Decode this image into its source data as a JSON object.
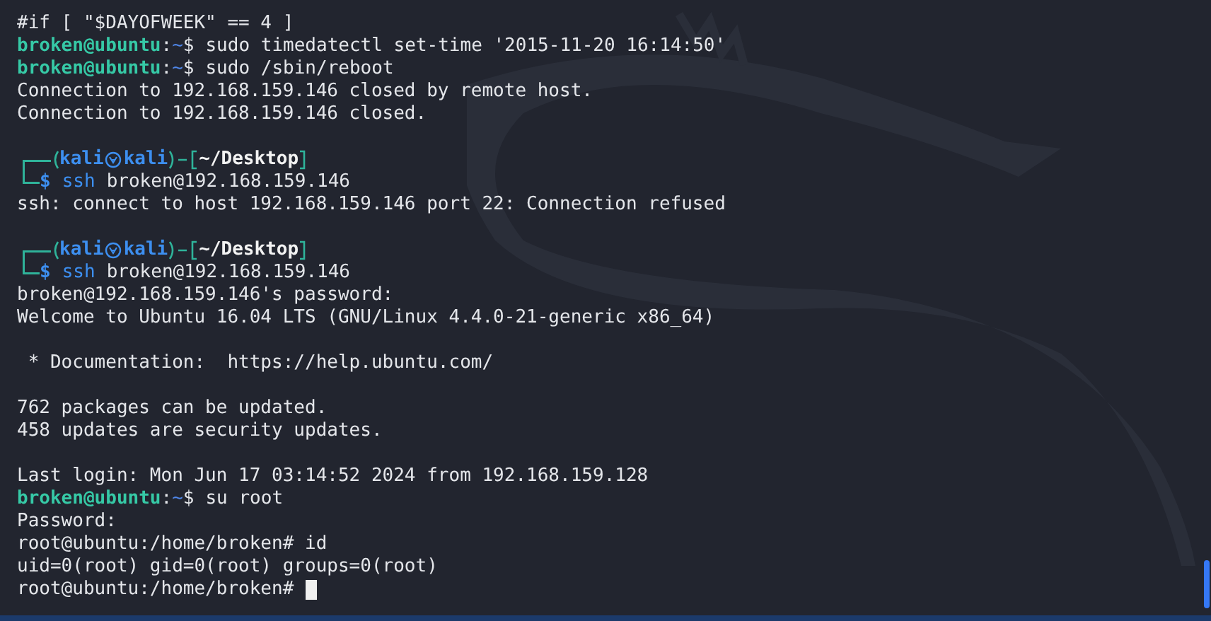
{
  "terminal": {
    "lines": [
      {
        "kind": "plain",
        "text": "#if [ \"$DAYOFWEEK\" == 4 ]"
      },
      {
        "kind": "ubuntu_prompt",
        "user_host": "broken@ubuntu",
        "separator": ":",
        "path": "~",
        "symbol": "$",
        "command": "sudo timedatectl set-time '2015-11-20 16:14:50'"
      },
      {
        "kind": "ubuntu_prompt",
        "user_host": "broken@ubuntu",
        "separator": ":",
        "path": "~",
        "symbol": "$",
        "command": "sudo /sbin/reboot"
      },
      {
        "kind": "plain",
        "text": "Connection to 192.168.159.146 closed by remote host."
      },
      {
        "kind": "plain",
        "text": "Connection to 192.168.159.146 closed."
      },
      {
        "kind": "blank"
      },
      {
        "kind": "kali_prompt",
        "user": "kali",
        "host": "kali",
        "directory": "~/Desktop",
        "symbol": "$",
        "program": "ssh",
        "arguments": "broken@192.168.159.146"
      },
      {
        "kind": "plain",
        "text": "ssh: connect to host 192.168.159.146 port 22: Connection refused"
      },
      {
        "kind": "blank"
      },
      {
        "kind": "kali_prompt",
        "user": "kali",
        "host": "kali",
        "directory": "~/Desktop",
        "symbol": "$",
        "program": "ssh",
        "arguments": "broken@192.168.159.146"
      },
      {
        "kind": "plain",
        "text": "broken@192.168.159.146's password:"
      },
      {
        "kind": "plain",
        "text": "Welcome to Ubuntu 16.04 LTS (GNU/Linux 4.4.0-21-generic x86_64)"
      },
      {
        "kind": "blank"
      },
      {
        "kind": "plain",
        "text": " * Documentation:  https://help.ubuntu.com/"
      },
      {
        "kind": "blank"
      },
      {
        "kind": "plain",
        "text": "762 packages can be updated."
      },
      {
        "kind": "plain",
        "text": "458 updates are security updates."
      },
      {
        "kind": "blank"
      },
      {
        "kind": "plain",
        "text": "Last login: Mon Jun 17 03:14:52 2024 from 192.168.159.128"
      },
      {
        "kind": "ubuntu_prompt",
        "user_host": "broken@ubuntu",
        "separator": ":",
        "path": "~",
        "symbol": "$",
        "command": "su root"
      },
      {
        "kind": "plain",
        "text": "Password:"
      },
      {
        "kind": "plain",
        "text": "root@ubuntu:/home/broken# id"
      },
      {
        "kind": "plain",
        "text": "uid=0(root) gid=0(root) groups=0(root)"
      },
      {
        "kind": "plain",
        "text": "root@ubuntu:/home/broken#",
        "cursor": true
      }
    ]
  }
}
